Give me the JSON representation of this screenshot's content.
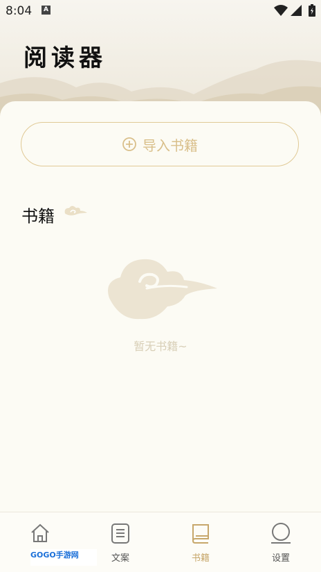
{
  "status_bar": {
    "time": "8:04",
    "notification_badge": "A"
  },
  "header": {
    "title": "阅读器"
  },
  "import_button": {
    "label": "导入书籍"
  },
  "section": {
    "title": "书籍"
  },
  "empty_state": {
    "message": "暂无书籍~"
  },
  "tabs": [
    {
      "label": "首页",
      "icon": "home-icon",
      "active": false
    },
    {
      "label": "文案",
      "icon": "document-icon",
      "active": false
    },
    {
      "label": "书籍",
      "icon": "book-icon",
      "active": true
    },
    {
      "label": "设置",
      "icon": "settings-icon",
      "active": false
    }
  ],
  "watermark": {
    "text": "GOGO手游网"
  },
  "colors": {
    "accent": "#c7a76b",
    "background": "#faf8f0",
    "button_border": "#e0c995"
  }
}
